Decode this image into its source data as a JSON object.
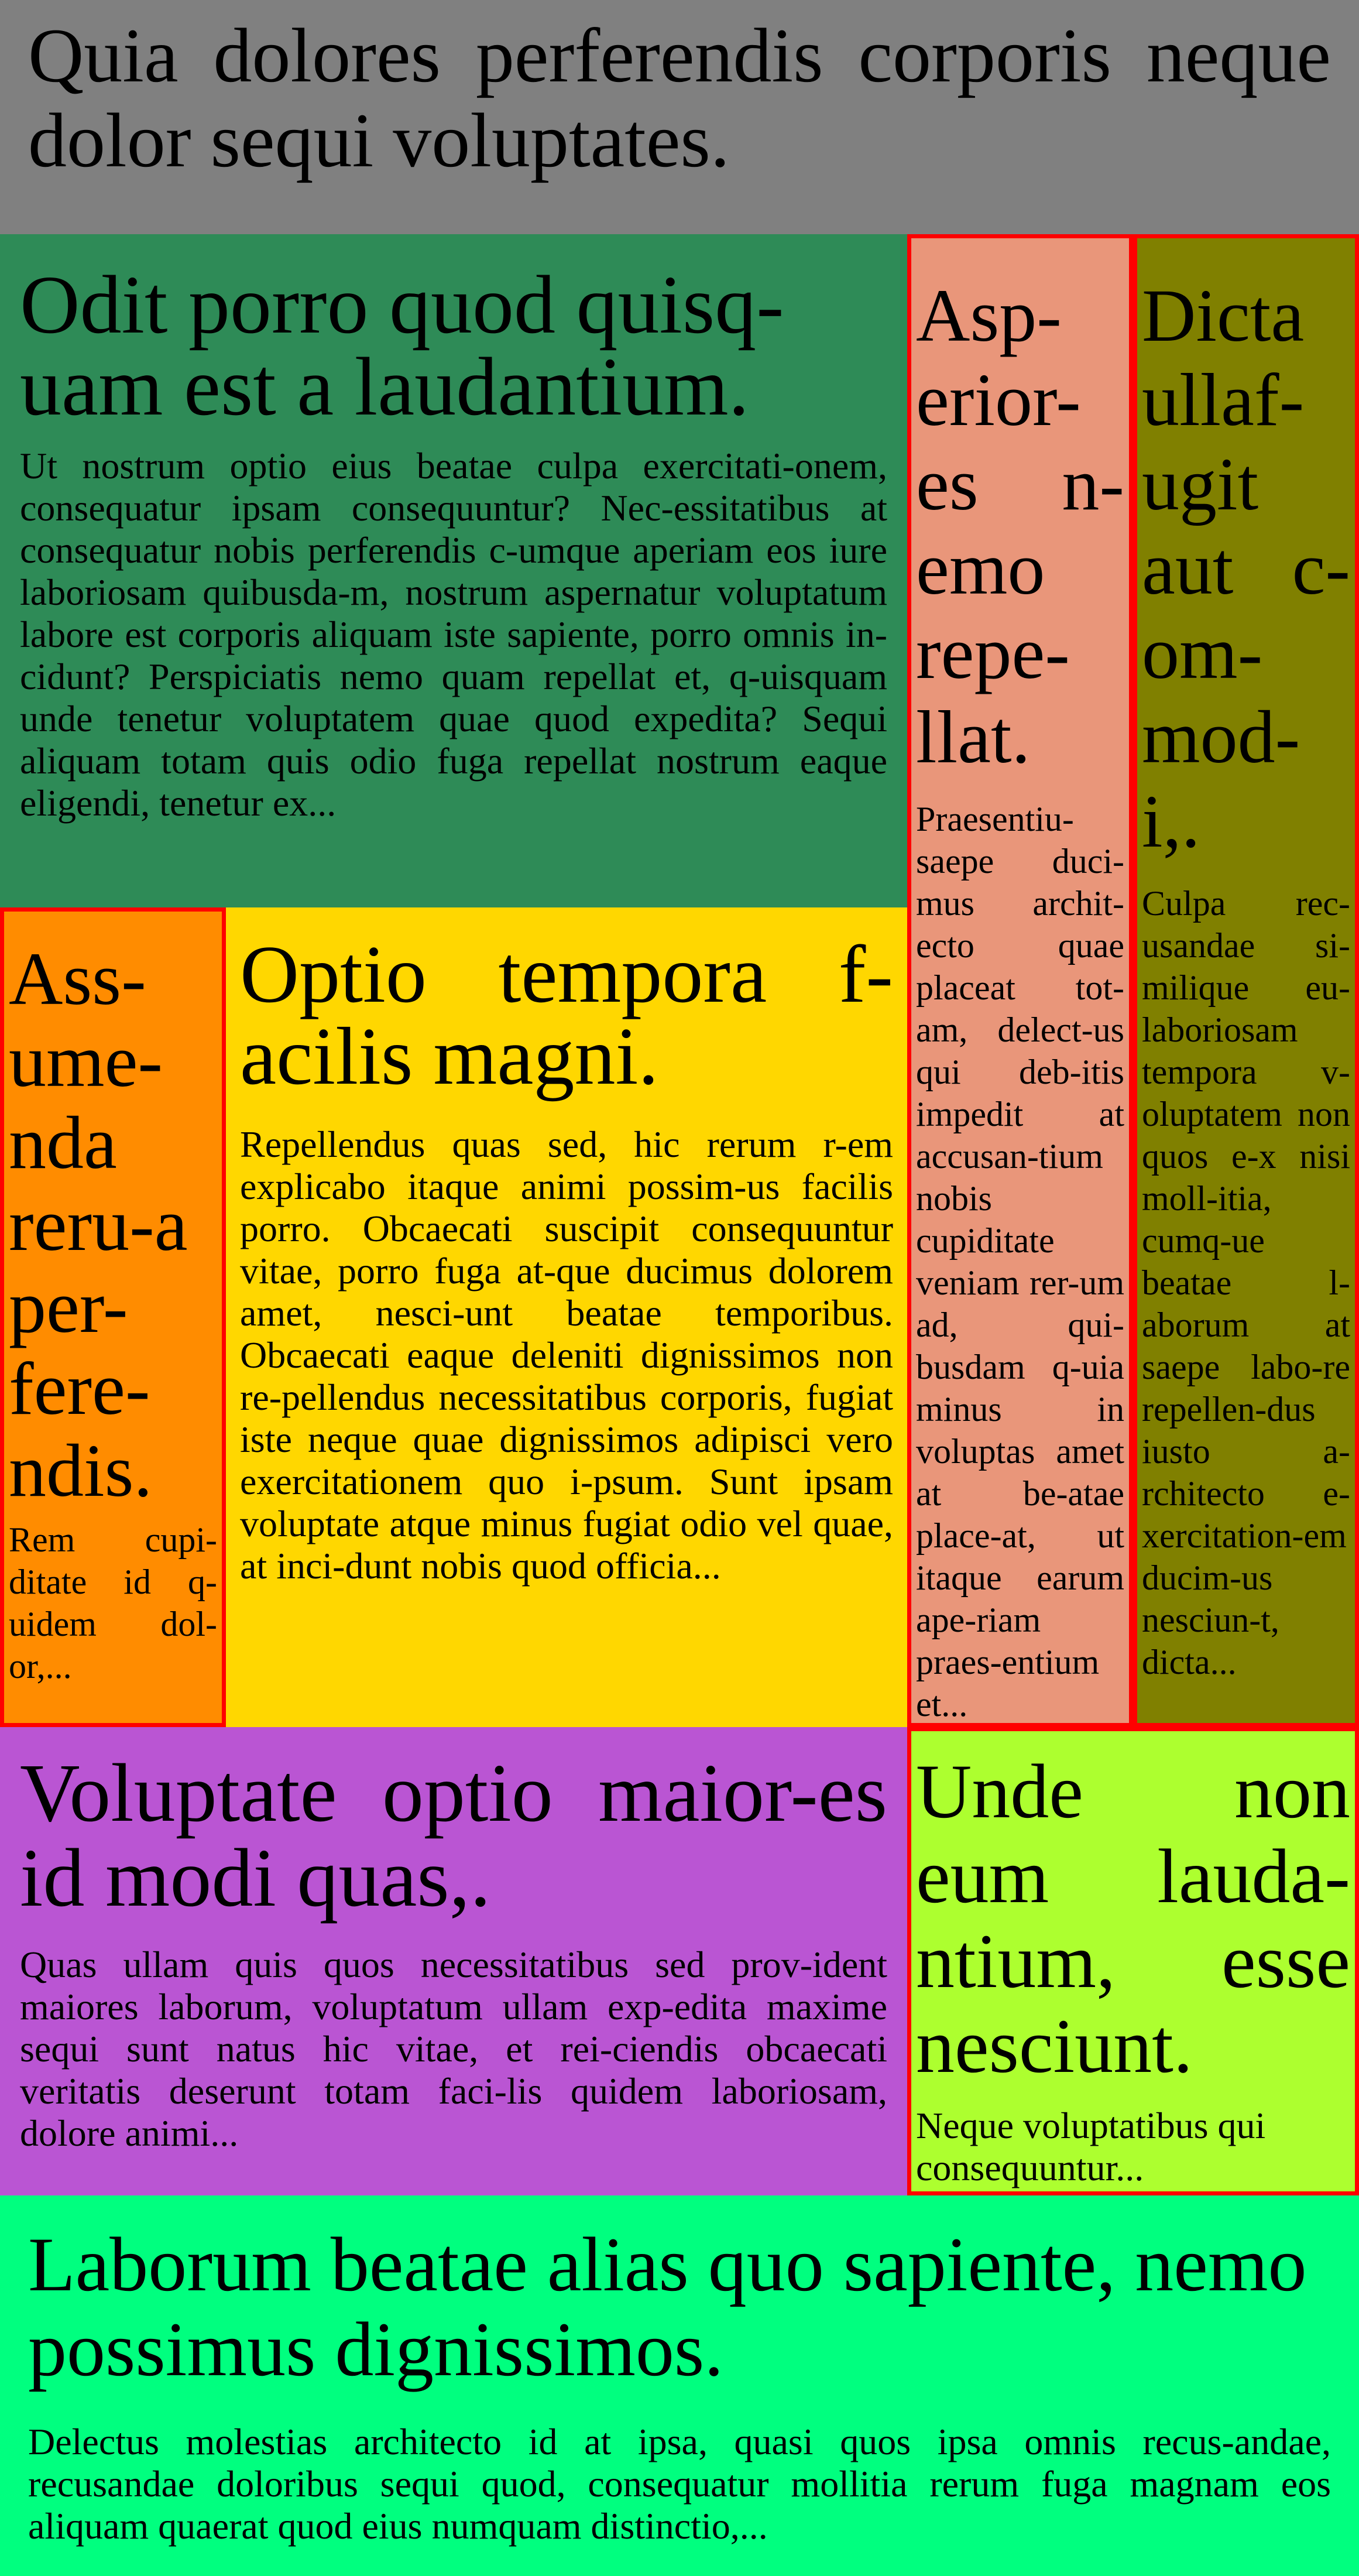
{
  "header": {
    "title": "Quia dolores perferendis corporis neque dolor sequi voluptates.",
    "color": "#808080"
  },
  "panels": {
    "odit": {
      "color": "#2e8b57",
      "heading": "Odit porro quod quisq-uam est a laudantium.",
      "body": "Ut nostrum optio eius beatae culpa exercitati-onem, consequatur ipsam consequuntur? Nec-essitatibus at consequatur nobis perferendis c-umque aperiam eos iure laboriosam quibusda-m, nostrum aspernatur voluptatum labore est corporis aliquam iste sapiente, porro omnis in-cidunt? Perspiciatis nemo quam repellat et, q-uisquam unde tenetur voluptatem quae quod expedita? Sequi aliquam totam quis odio fuga repellat nostrum eaque eligendi, tenetur ex..."
    },
    "asperiores": {
      "color": "#e9967a",
      "heading": "Asp-erior-es n-emo repe-llat.",
      "body": "Praesentiu-saepe duci-mus archit-ecto quae placeat tot-am, delect-us qui deb-itis impedit at accusan-tium nobis cupiditate veniam rer-um ad, qui-busdam q-uia minus in voluptas amet at be-atae place-at, ut itaque earum ape-riam praes-entium et..."
    },
    "dicta": {
      "color": "#808000",
      "heading": "Dicta ullaf-ugit aut c-om-mod-i,.",
      "body": "Culpa rec-usandae si-milique eu-laboriosam tempora v-oluptatem non quos e-x nisi moll-itia, cumq-ue beatae l-aborum at saepe labo-re repellen-dus iusto a-rchitecto e-xercitation-em ducim-us nesciun-t, dicta..."
    },
    "assumenda": {
      "color": "#ff8c00",
      "heading": "Ass-ume-nda reru-a per-fere-ndis.",
      "body": "Rem cupi-ditate id q-uidem dol-or,..."
    },
    "optio": {
      "color": "#ffd700",
      "heading": "Optio tempora f-acilis magni.",
      "body": "Repellendus quas sed, hic rerum r-em explicabo itaque animi possim-us facilis porro. Obcaecati suscipit consequuntur vitae, porro fuga at-que ducimus dolorem amet, nesci-unt beatae temporibus. Obcaecati eaque deleniti dignissimos non re-pellendus necessitatibus corporis, fugiat iste neque quae dignissimos adipisci vero exercitationem quo i-psum. Sunt ipsam voluptate atque minus fugiat odio vel quae, at inci-dunt nobis quod officia..."
    },
    "voluptate": {
      "color": "#ba55d3",
      "heading": "Voluptate optio maior-es id modi quas,.",
      "body": "Quas ullam quis quos necessitatibus sed prov-ident maiores laborum, voluptatum ullam exp-edita maxime sequi sunt natus hic vitae, et rei-ciendis obcaecati veritatis deserunt totam faci-lis quidem laboriosam, dolore animi..."
    },
    "unde": {
      "color": "#adff2f",
      "heading": "Unde non eum lauda-ntium, esse nesciunt.",
      "body": "Neque voluptatibus qui consequuntur..."
    },
    "laborum": {
      "color": "#00ff7f",
      "heading": "Laborum beatae alias quo sapiente, nemo possimus dignissimos.",
      "body": "Delectus molestias architecto id at ipsa, quasi quos ipsa omnis recus-andae, recusandae doloribus sequi quod, consequatur mollitia rerum fuga magnam eos aliquam quaerat quod eius numquam distinctio,..."
    }
  }
}
